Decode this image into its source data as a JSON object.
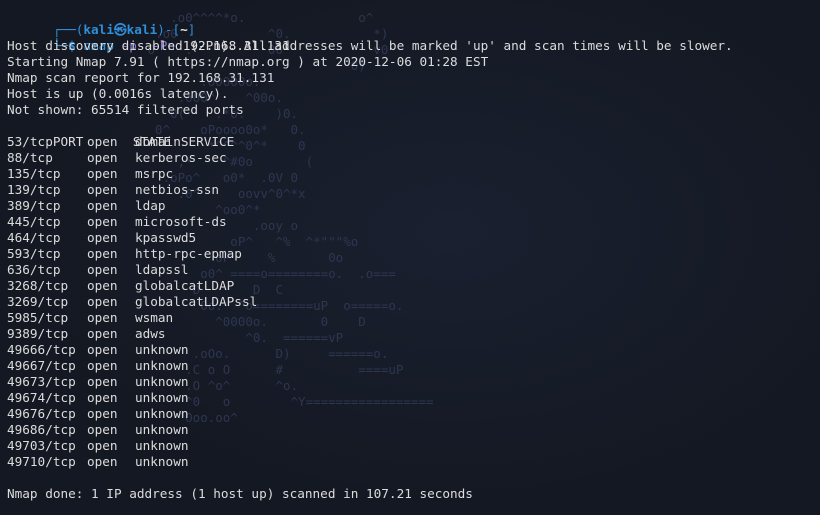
{
  "prompt": {
    "top_left": "┌──(",
    "user": "kali㉿kali",
    "mid": ")-[",
    "dir": "~",
    "end": "]",
    "bottom": "└─",
    "dollar": "$ "
  },
  "command": {
    "name": "nmap",
    "flag1": "-p-",
    "flag2": "-Pn",
    "target": "192.168.31.131"
  },
  "output": {
    "warning": "Host discovery disabled (-Pn). All addresses will be marked 'up' and scan times will be slower.",
    "starting": "Starting Nmap 7.91 ( https://nmap.org ) at 2020-12-06 01:28 EST",
    "report": "Nmap scan report for 192.168.31.131",
    "host_up": "Host is up (0.0016s latency).",
    "not_shown": "Not shown: 65514 filtered ports",
    "headers": {
      "port": "PORT",
      "state": "STATE",
      "service": "SERVICE"
    },
    "ports": [
      {
        "port": "53/tcp",
        "state": "open",
        "service": "domain"
      },
      {
        "port": "88/tcp",
        "state": "open",
        "service": "kerberos-sec"
      },
      {
        "port": "135/tcp",
        "state": "open",
        "service": "msrpc"
      },
      {
        "port": "139/tcp",
        "state": "open",
        "service": "netbios-ssn"
      },
      {
        "port": "389/tcp",
        "state": "open",
        "service": "ldap"
      },
      {
        "port": "445/tcp",
        "state": "open",
        "service": "microsoft-ds"
      },
      {
        "port": "464/tcp",
        "state": "open",
        "service": "kpasswd5"
      },
      {
        "port": "593/tcp",
        "state": "open",
        "service": "http-rpc-epmap"
      },
      {
        "port": "636/tcp",
        "state": "open",
        "service": "ldapssl"
      },
      {
        "port": "3268/tcp",
        "state": "open",
        "service": "globalcatLDAP"
      },
      {
        "port": "3269/tcp",
        "state": "open",
        "service": "globalcatLDAPssl"
      },
      {
        "port": "5985/tcp",
        "state": "open",
        "service": "wsman"
      },
      {
        "port": "9389/tcp",
        "state": "open",
        "service": "adws"
      },
      {
        "port": "49666/tcp",
        "state": "open",
        "service": "unknown"
      },
      {
        "port": "49667/tcp",
        "state": "open",
        "service": "unknown"
      },
      {
        "port": "49673/tcp",
        "state": "open",
        "service": "unknown"
      },
      {
        "port": "49674/tcp",
        "state": "open",
        "service": "unknown"
      },
      {
        "port": "49676/tcp",
        "state": "open",
        "service": "unknown"
      },
      {
        "port": "49686/tcp",
        "state": "open",
        "service": "unknown"
      },
      {
        "port": "49703/tcp",
        "state": "open",
        "service": "unknown"
      },
      {
        "port": "49710/tcp",
        "state": "open",
        "service": "unknown"
      }
    ],
    "done": "Nmap done: 1 IP address (1 host up) scanned in 107.21 seconds"
  },
  "colors": {
    "background": "#151a24",
    "prompt": "#2f8fd8",
    "flag": "#8b7bd8",
    "text": "#dcdcdc"
  }
}
